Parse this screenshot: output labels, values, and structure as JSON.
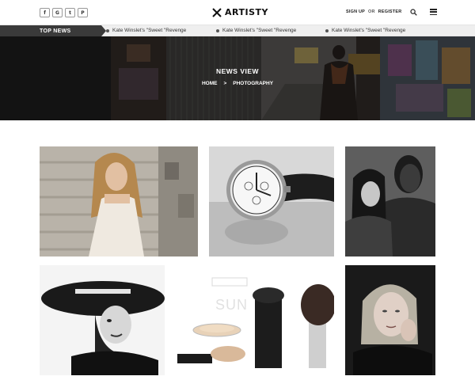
{
  "header": {
    "socials": [
      {
        "icon": "facebook-icon",
        "glyph": "f"
      },
      {
        "icon": "google-icon",
        "glyph": "G"
      },
      {
        "icon": "twitter-icon",
        "glyph": "t"
      },
      {
        "icon": "pinterest-icon",
        "glyph": "P"
      }
    ],
    "logo_text": "ARTISTY",
    "sign_up": "SIGN UP",
    "or": "OR",
    "register": "REGISTER"
  },
  "ticker": {
    "label": "TOP NEWS",
    "items": [
      "Kate Winslet's \"Sweet \"Revenge",
      "Kate Winslet's \"Sweet \"Revenge",
      "Kate Winslet's \"Sweet \"Revenge"
    ]
  },
  "hero": {
    "title": "NEWS VIEW",
    "breadcrumb": {
      "home": "HOME",
      "separator": ">",
      "current": "PHOTOGRAPHY"
    }
  },
  "gallery": {
    "tiles": [
      {
        "name": "woman-on-steps-photo"
      },
      {
        "name": "wristwatch-photo"
      },
      {
        "name": "two-women-portrait-photo"
      },
      {
        "name": "woman-in-hat-photo"
      },
      {
        "name": "makeup-products-photo",
        "brand": "SUNNY"
      },
      {
        "name": "blonde-woman-portrait-photo"
      }
    ]
  },
  "colors": {
    "ticker_label_bg": "#3a3a3a",
    "ticker_bg": "#efefef",
    "hero_overlay": "#000000"
  }
}
